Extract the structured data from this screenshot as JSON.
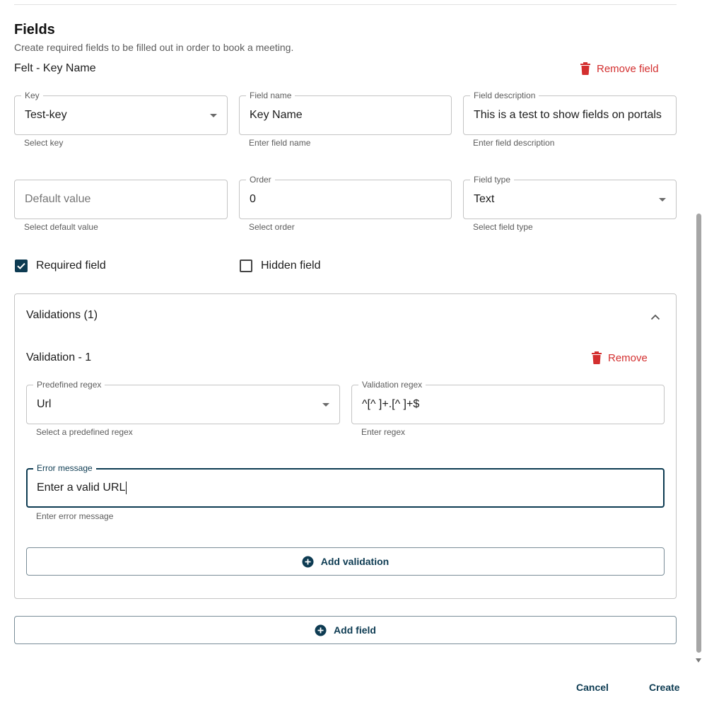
{
  "section": {
    "title": "Fields",
    "subtitle": "Create required fields to be filled out in order to book a meeting."
  },
  "field_item": {
    "title": "Felt - Key Name",
    "remove_label": "Remove field",
    "key": {
      "legend": "Key",
      "value": "Test-key",
      "helper": "Select key"
    },
    "field_name": {
      "legend": "Field name",
      "value": "Key Name",
      "helper": "Enter field name"
    },
    "field_description": {
      "legend": "Field description",
      "value": "This is a test to show fields on portals",
      "helper": "Enter field description"
    },
    "default_value": {
      "placeholder": "Default value",
      "helper": "Select default value"
    },
    "order": {
      "legend": "Order",
      "value": "0",
      "helper": "Select order"
    },
    "field_type": {
      "legend": "Field type",
      "value": "Text",
      "helper": "Select field type"
    },
    "required": {
      "label": "Required field",
      "checked": true
    },
    "hidden": {
      "label": "Hidden field",
      "checked": false
    }
  },
  "validations": {
    "title": "Validations (1)",
    "items": [
      {
        "title": "Validation - 1",
        "remove_label": "Remove",
        "predefined_regex": {
          "legend": "Predefined regex",
          "value": "Url",
          "helper": "Select a predefined regex"
        },
        "validation_regex": {
          "legend": "Validation regex",
          "value": "^[^ ]+.[^ ]+$",
          "helper": "Enter regex"
        },
        "error_message": {
          "legend": "Error message",
          "value": "Enter a valid URL",
          "helper": "Enter error message"
        }
      }
    ],
    "add_label": "Add validation"
  },
  "add_field_label": "Add field",
  "footer": {
    "cancel": "Cancel",
    "create": "Create"
  },
  "colors": {
    "primary": "#0d3b52",
    "danger": "#d32f2f",
    "border": "#c4c4c4"
  }
}
